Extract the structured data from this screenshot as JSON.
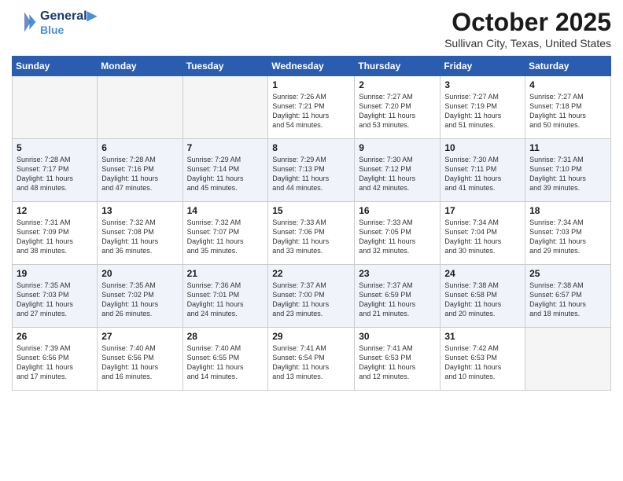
{
  "header": {
    "logo_line1": "General",
    "logo_line2": "Blue",
    "month": "October 2025",
    "location": "Sullivan City, Texas, United States"
  },
  "days_of_week": [
    "Sunday",
    "Monday",
    "Tuesday",
    "Wednesday",
    "Thursday",
    "Friday",
    "Saturday"
  ],
  "weeks": [
    [
      {
        "day": "",
        "info": ""
      },
      {
        "day": "",
        "info": ""
      },
      {
        "day": "",
        "info": ""
      },
      {
        "day": "1",
        "info": "Sunrise: 7:26 AM\nSunset: 7:21 PM\nDaylight: 11 hours\nand 54 minutes."
      },
      {
        "day": "2",
        "info": "Sunrise: 7:27 AM\nSunset: 7:20 PM\nDaylight: 11 hours\nand 53 minutes."
      },
      {
        "day": "3",
        "info": "Sunrise: 7:27 AM\nSunset: 7:19 PM\nDaylight: 11 hours\nand 51 minutes."
      },
      {
        "day": "4",
        "info": "Sunrise: 7:27 AM\nSunset: 7:18 PM\nDaylight: 11 hours\nand 50 minutes."
      }
    ],
    [
      {
        "day": "5",
        "info": "Sunrise: 7:28 AM\nSunset: 7:17 PM\nDaylight: 11 hours\nand 48 minutes."
      },
      {
        "day": "6",
        "info": "Sunrise: 7:28 AM\nSunset: 7:16 PM\nDaylight: 11 hours\nand 47 minutes."
      },
      {
        "day": "7",
        "info": "Sunrise: 7:29 AM\nSunset: 7:14 PM\nDaylight: 11 hours\nand 45 minutes."
      },
      {
        "day": "8",
        "info": "Sunrise: 7:29 AM\nSunset: 7:13 PM\nDaylight: 11 hours\nand 44 minutes."
      },
      {
        "day": "9",
        "info": "Sunrise: 7:30 AM\nSunset: 7:12 PM\nDaylight: 11 hours\nand 42 minutes."
      },
      {
        "day": "10",
        "info": "Sunrise: 7:30 AM\nSunset: 7:11 PM\nDaylight: 11 hours\nand 41 minutes."
      },
      {
        "day": "11",
        "info": "Sunrise: 7:31 AM\nSunset: 7:10 PM\nDaylight: 11 hours\nand 39 minutes."
      }
    ],
    [
      {
        "day": "12",
        "info": "Sunrise: 7:31 AM\nSunset: 7:09 PM\nDaylight: 11 hours\nand 38 minutes."
      },
      {
        "day": "13",
        "info": "Sunrise: 7:32 AM\nSunset: 7:08 PM\nDaylight: 11 hours\nand 36 minutes."
      },
      {
        "day": "14",
        "info": "Sunrise: 7:32 AM\nSunset: 7:07 PM\nDaylight: 11 hours\nand 35 minutes."
      },
      {
        "day": "15",
        "info": "Sunrise: 7:33 AM\nSunset: 7:06 PM\nDaylight: 11 hours\nand 33 minutes."
      },
      {
        "day": "16",
        "info": "Sunrise: 7:33 AM\nSunset: 7:05 PM\nDaylight: 11 hours\nand 32 minutes."
      },
      {
        "day": "17",
        "info": "Sunrise: 7:34 AM\nSunset: 7:04 PM\nDaylight: 11 hours\nand 30 minutes."
      },
      {
        "day": "18",
        "info": "Sunrise: 7:34 AM\nSunset: 7:03 PM\nDaylight: 11 hours\nand 29 minutes."
      }
    ],
    [
      {
        "day": "19",
        "info": "Sunrise: 7:35 AM\nSunset: 7:03 PM\nDaylight: 11 hours\nand 27 minutes."
      },
      {
        "day": "20",
        "info": "Sunrise: 7:35 AM\nSunset: 7:02 PM\nDaylight: 11 hours\nand 26 minutes."
      },
      {
        "day": "21",
        "info": "Sunrise: 7:36 AM\nSunset: 7:01 PM\nDaylight: 11 hours\nand 24 minutes."
      },
      {
        "day": "22",
        "info": "Sunrise: 7:37 AM\nSunset: 7:00 PM\nDaylight: 11 hours\nand 23 minutes."
      },
      {
        "day": "23",
        "info": "Sunrise: 7:37 AM\nSunset: 6:59 PM\nDaylight: 11 hours\nand 21 minutes."
      },
      {
        "day": "24",
        "info": "Sunrise: 7:38 AM\nSunset: 6:58 PM\nDaylight: 11 hours\nand 20 minutes."
      },
      {
        "day": "25",
        "info": "Sunrise: 7:38 AM\nSunset: 6:57 PM\nDaylight: 11 hours\nand 18 minutes."
      }
    ],
    [
      {
        "day": "26",
        "info": "Sunrise: 7:39 AM\nSunset: 6:56 PM\nDaylight: 11 hours\nand 17 minutes."
      },
      {
        "day": "27",
        "info": "Sunrise: 7:40 AM\nSunset: 6:56 PM\nDaylight: 11 hours\nand 16 minutes."
      },
      {
        "day": "28",
        "info": "Sunrise: 7:40 AM\nSunset: 6:55 PM\nDaylight: 11 hours\nand 14 minutes."
      },
      {
        "day": "29",
        "info": "Sunrise: 7:41 AM\nSunset: 6:54 PM\nDaylight: 11 hours\nand 13 minutes."
      },
      {
        "day": "30",
        "info": "Sunrise: 7:41 AM\nSunset: 6:53 PM\nDaylight: 11 hours\nand 12 minutes."
      },
      {
        "day": "31",
        "info": "Sunrise: 7:42 AM\nSunset: 6:53 PM\nDaylight: 11 hours\nand 10 minutes."
      },
      {
        "day": "",
        "info": ""
      }
    ]
  ]
}
